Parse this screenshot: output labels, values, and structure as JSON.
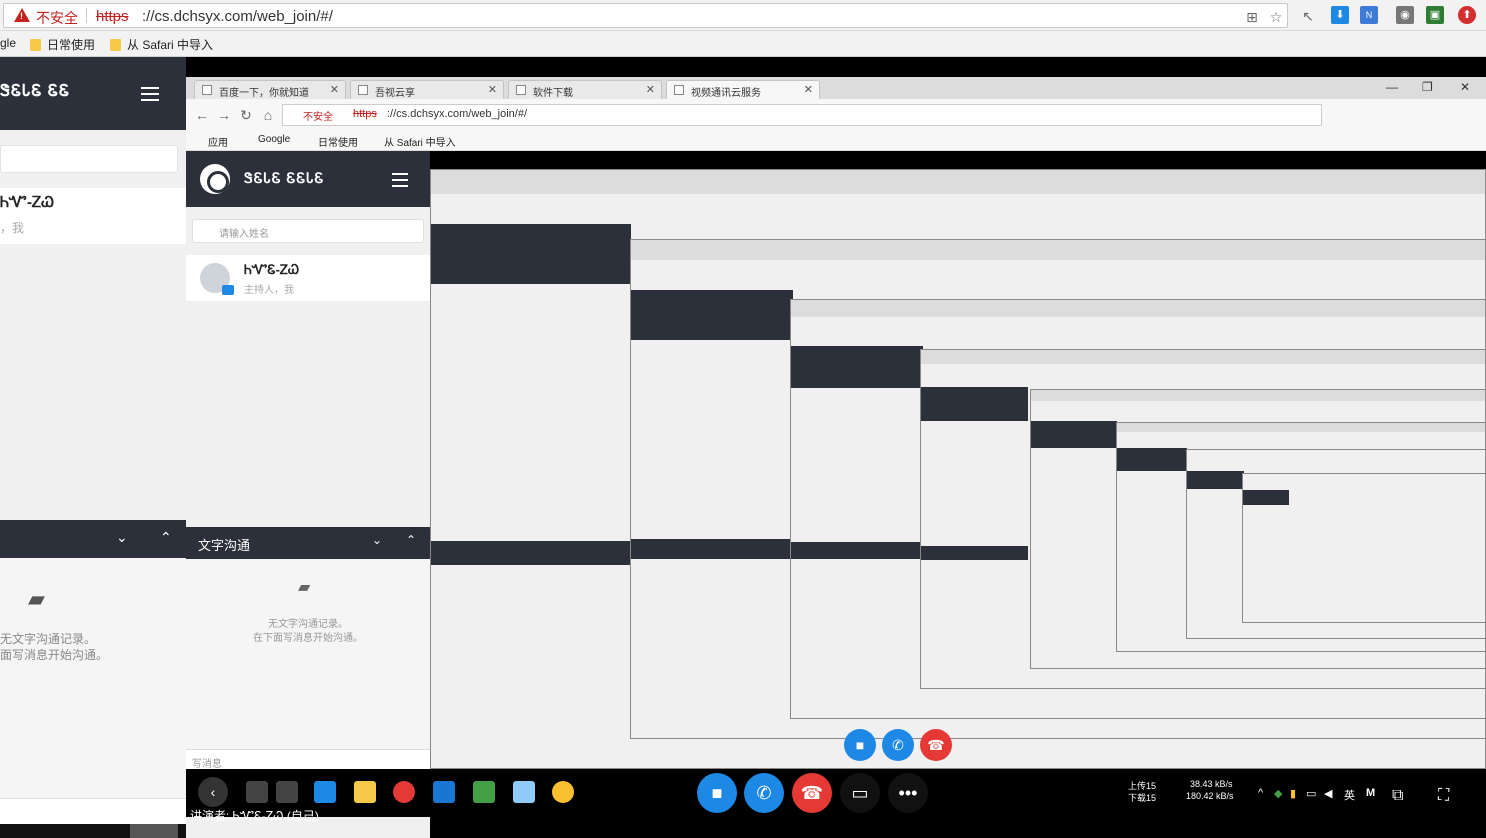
{
  "browser": {
    "insecure_label": "不安全",
    "url_proto": "https",
    "url_rest": "://cs.dchsyx.com/web_join/#/",
    "bookmarks": [
      {
        "label": "gle"
      },
      {
        "label": "日常使用"
      },
      {
        "label": "从 Safari 中导入"
      }
    ]
  },
  "left_panel": {
    "title": "ᏕᏋᏓᏋ ᏋᏋ",
    "participant_name": "ᏂᏉ-ᏃᏇ",
    "participant_role": "，我",
    "empty_line1": "无文字沟通记录。",
    "empty_line2": "面写消息开始沟通。"
  },
  "inner": {
    "tabs": [
      {
        "label": "百度一下，你就知道"
      },
      {
        "label": "吾视云享"
      },
      {
        "label": "软件下载"
      },
      {
        "label": "视频通讯云服务"
      }
    ],
    "url_proto": "https",
    "url_rest": "://cs.dchsyx.com/web_join/#/",
    "insecure_label": "不安全",
    "bookmarks": [
      {
        "label": "应用"
      },
      {
        "label": "Google"
      },
      {
        "label": "日常使用"
      },
      {
        "label": "从 Safari 中导入"
      }
    ],
    "title": "ᏕᏋᏓᏋ ᏋᏋᏓᏋ",
    "search_placeholder": "请输入姓名",
    "participant_name": "ᏂᏉᏋ-ᏃᏇ",
    "participant_role": "主持人，我",
    "chat_label": "文字沟通",
    "empty_line1": "无文字沟通记录。",
    "empty_line2": "在下面写消息开始沟通。",
    "write_placeholder": "写消息"
  },
  "footer": {
    "speaker_label": "讲演者: ᏂᏉᏋ-ᏃᏇ (自己)",
    "net_up_label": "上传15",
    "net_down_label": "下载15",
    "net_up_value": "38.43 kB/s",
    "net_down_value": "180.42 kB/s",
    "ime_label": "英",
    "ime_m": "M"
  },
  "colors": {
    "header_bg": "#2b303b",
    "accent_blue": "#1e88e5",
    "hangup_red": "#e53935",
    "insecure_red": "#c5221f"
  }
}
